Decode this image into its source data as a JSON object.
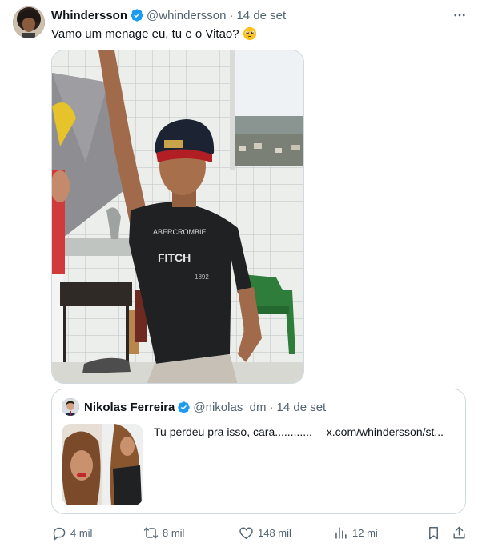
{
  "tweet": {
    "author_name": "Whindersson",
    "handle": "@whindersson",
    "separator": "·",
    "date": "14 de set",
    "text": "Vamo um menage eu, tu e o Vitao?",
    "emoji": "pleading-face-emoji",
    "verified": true,
    "photo": {
      "shirt_text_1": "ABERCROMBIE",
      "shirt_text_2": "FITCH",
      "shirt_text_3": "1892"
    }
  },
  "quoted_tweet": {
    "author_name": "Nikolas Ferreira",
    "handle": "@nikolas_dm",
    "separator": "·",
    "date": "14 de set",
    "text": "Tu perdeu pra isso, cara............",
    "link": "x.com/whindersson/st..."
  },
  "actions": {
    "reply_count": "4 mil",
    "retweet_count": "8 mil",
    "like_count": "148 mil",
    "views_count": "12 mi"
  },
  "colors": {
    "text": "#0f1419",
    "secondary": "#536471",
    "verified_blue": "#1d9bf0",
    "border": "#cfd9de"
  }
}
